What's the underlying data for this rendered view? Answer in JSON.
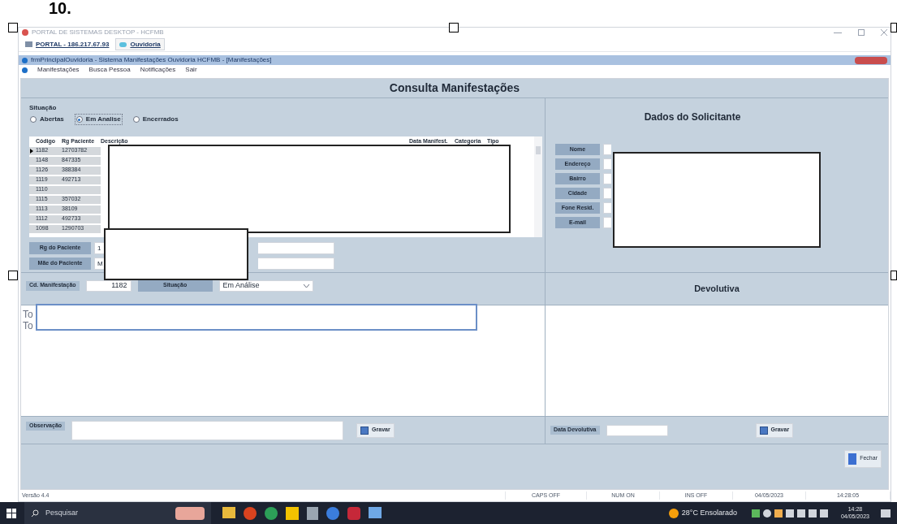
{
  "document_heading": "10.",
  "window": {
    "title": "PORTAL DE SISTEMAS DESKTOP - HCFMB"
  },
  "portal_tabs": [
    {
      "label": "PORTAL - 186.217.67.93",
      "selected": false
    },
    {
      "label": "Ouvidoria",
      "selected": true
    }
  ],
  "child_window": {
    "title": "frmPrincipalOuvidoria - Sistema Manifestações Ouvidoria HCFMB - [Manifestações]"
  },
  "menu": [
    "Manifestações",
    "Busca Pessoa",
    "Notificações",
    "Sair"
  ],
  "page_title": "Consulta Manifestações",
  "situacao": {
    "label": "Situação",
    "options": [
      {
        "label": "Abertas",
        "selected": false
      },
      {
        "label": "Em Analise",
        "selected": true
      },
      {
        "label": "Encerrados",
        "selected": false
      }
    ]
  },
  "table": {
    "columns": [
      "Código",
      "Rg Paciente",
      "Descrição",
      "Data Manifest.",
      "Categoria",
      "Tipo"
    ],
    "rows": [
      {
        "codigo": "1182",
        "rg": "12703782",
        "selected": true
      },
      {
        "codigo": "1148",
        "rg": "847335",
        "selected": false
      },
      {
        "codigo": "1126",
        "rg": "388384",
        "selected": false
      },
      {
        "codigo": "1119",
        "rg": "492713",
        "selected": false
      },
      {
        "codigo": "1110",
        "rg": "",
        "selected": false
      },
      {
        "codigo": "1115",
        "rg": "357032",
        "selected": false
      },
      {
        "codigo": "1113",
        "rg": "38109",
        "selected": false
      },
      {
        "codigo": "1112",
        "rg": "492733",
        "selected": false
      },
      {
        "codigo": "1098",
        "rg": "1290703",
        "selected": false
      }
    ]
  },
  "patient_fields": [
    {
      "label": "Rg do Paciente",
      "value": "1"
    },
    {
      "label": "Mãe do Paciente",
      "value": "M"
    }
  ],
  "solicitante": {
    "title": "Dados do Solicitante",
    "fields": [
      "Nome",
      "Endereço",
      "Bairro",
      "Cidade",
      "Fone Resid.",
      "E-mail"
    ]
  },
  "manifestacao": {
    "code_label": "Cd. Manifestação",
    "code_value": "1182",
    "status_label": "Situação",
    "status_value": "Em Análise"
  },
  "devolutiva_title": "Devolutiva",
  "text_lines": [
    "To",
    "To"
  ],
  "observacao_label": "Observação",
  "save_left": "Gravar",
  "data_devolutiva_label": "Data Devolutiva",
  "save_right": "Gravar",
  "close_button": "Fechar",
  "status_bar": [
    "Versão 4.4",
    "CAPS OFF",
    "NUM ON",
    "INS OFF",
    "04/05/2023",
    "14:28:05"
  ],
  "taskbar": {
    "search_placeholder": "Pesquisar",
    "weather": "28°C Ensolarado",
    "time": "14:28",
    "date": "04/05/2023"
  }
}
